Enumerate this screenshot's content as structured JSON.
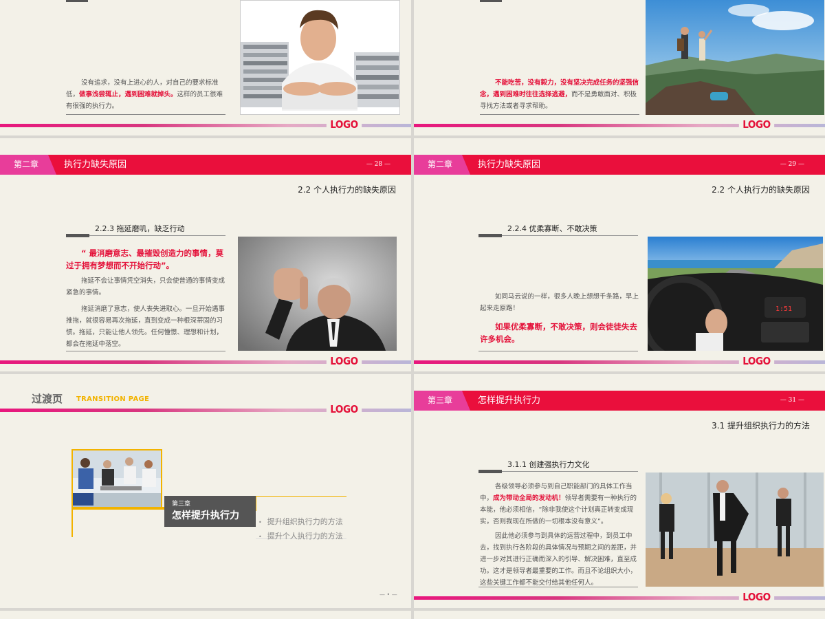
{
  "logo_text": "LOGO",
  "slide1": {
    "paragraph": [
      {
        "text": "没有追求，没有上进心的人，对自己的要求标准低，",
        "hl": false
      },
      {
        "text": "做事浅尝辄止，遇到困难就掉头。",
        "hl": true
      },
      {
        "text": "这样的员工很难有很强的执行力。",
        "hl": false
      }
    ]
  },
  "slide2": {
    "paragraph": [
      {
        "text": "不能吃苦，没有毅力，没有坚决完成任务的坚强信念，遇到困难时往往选择逃避，",
        "hl": true
      },
      {
        "text": "而不是勇敢面对、积极寻找方法或者寻求帮助。",
        "hl": false
      }
    ]
  },
  "slide3": {
    "chapter": "第二章",
    "title": "执行力缺失原因",
    "page": "— 28 —",
    "section": "2.2  个人执行力的缺失原因",
    "sub": "2.2.3  拖延磨叽，缺乏行动",
    "quote": "“ 最消磨意志、最摧毁创造力的事情，莫过于拥有梦想而不开始行动”。",
    "p1": "拖延不会让事情凭空消失，只会使普通的事情变成紧急的事情。",
    "p2": "拖延消磨了意志，使人丧失进取心。一旦开始遇事推拖，就很容易再次拖延，直到变成一种根深蒂固的习惯。拖延，只能让他人领先。任何憧憬、理想和计划，都会在拖延中落空。"
  },
  "slide4": {
    "chapter": "第二章",
    "title": "执行力缺失原因",
    "page": "— 29 —",
    "section": "2.2  个人执行力的缺失原因",
    "sub": "2.2.4  优柔寡断、不敢决策",
    "p1": "如同马云说的一样，很多人晚上想想千条路，早上起来走原路！",
    "red": "如果优柔寡断，不敢决策，则会徒徒失去许多机会。",
    "dash_clock": "1:51"
  },
  "slide5": {
    "title": "过渡页",
    "title_en": "TRANSITION PAGE",
    "chapter": "第三章",
    "chapter_title": "怎样提升执行力",
    "bullets": [
      "提升组织执行力的方法",
      "提升个人执行力的方法"
    ],
    "page": "— • —"
  },
  "slide6": {
    "chapter": "第三章",
    "title": "怎样提升执行力",
    "page": "— 31 —",
    "section": "3.1  提升组织执行力的方法",
    "sub": "3.1.1  创建强执行力文化",
    "p1": [
      {
        "text": "各级领导必须参与到自己职能部门的具体工作当中，",
        "hl": false
      },
      {
        "text": "成为带动全局的发动机！",
        "hl": true
      },
      {
        "text": "领导者需要有一种执行的本能，他必须相信，“除非我使这个计划真正转变成现实，否则我现在所做的一切根本没有意义”。",
        "hl": false
      }
    ],
    "p2": "因此他必须参与到具体的运营过程中，到员工中去，找到执行各阶段的具体情况与预期之间的差距，并进一步对其进行正确而深入的引导、解决困难，直至成功。这才是领导者最重要的工作。而且不论组织大小，这些关键工作都不能交付给其他任何人。"
  }
}
